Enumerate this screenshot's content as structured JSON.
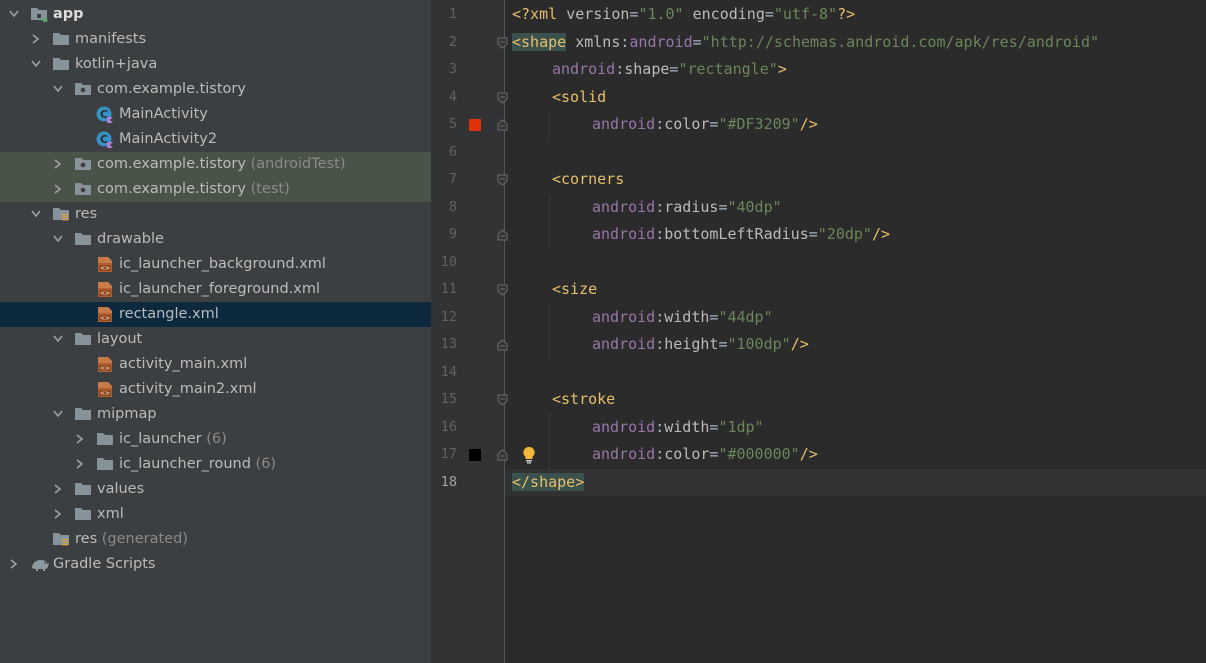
{
  "tree": [
    {
      "label": "app",
      "extra": "",
      "bold": true,
      "icon": "app-module-icon",
      "arrow": "expanded",
      "depth": 0,
      "bg": "none"
    },
    {
      "label": "manifests",
      "extra": "",
      "icon": "folder-icon",
      "arrow": "collapsed",
      "depth": 1,
      "bg": "none"
    },
    {
      "label": "kotlin+java",
      "extra": "",
      "icon": "folder-icon",
      "arrow": "expanded",
      "depth": 1,
      "bg": "none"
    },
    {
      "label": "com.example.tistory",
      "extra": "",
      "icon": "package-icon",
      "arrow": "expanded",
      "depth": 2,
      "bg": "none"
    },
    {
      "label": "MainActivity",
      "extra": "",
      "icon": "kotlin-class-icon",
      "arrow": "none",
      "depth": 3,
      "bg": "none"
    },
    {
      "label": "MainActivity2",
      "extra": "",
      "icon": "kotlin-class-icon",
      "arrow": "none",
      "depth": 3,
      "bg": "none"
    },
    {
      "label": "com.example.tistory",
      "extra": " (androidTest)",
      "icon": "package-icon",
      "arrow": "collapsed",
      "depth": 2,
      "bg": "test"
    },
    {
      "label": "com.example.tistory",
      "extra": " (test)",
      "icon": "package-icon",
      "arrow": "collapsed",
      "depth": 2,
      "bg": "test"
    },
    {
      "label": "res",
      "extra": "",
      "icon": "res-folder-icon",
      "arrow": "expanded",
      "depth": 1,
      "bg": "none"
    },
    {
      "label": "drawable",
      "extra": "",
      "icon": "folder-icon",
      "arrow": "expanded",
      "depth": 2,
      "bg": "none"
    },
    {
      "label": "ic_launcher_background.xml",
      "extra": "",
      "icon": "xml-file-icon",
      "arrow": "none",
      "depth": 3,
      "bg": "none"
    },
    {
      "label": "ic_launcher_foreground.xml",
      "extra": "",
      "icon": "xml-file-icon",
      "arrow": "none",
      "depth": 3,
      "bg": "none"
    },
    {
      "label": "rectangle.xml",
      "extra": "",
      "icon": "xml-file-icon",
      "arrow": "none",
      "depth": 3,
      "bg": "selected"
    },
    {
      "label": "layout",
      "extra": "",
      "icon": "folder-icon",
      "arrow": "expanded",
      "depth": 2,
      "bg": "none"
    },
    {
      "label": "activity_main.xml",
      "extra": "",
      "icon": "xml-file-icon",
      "arrow": "none",
      "depth": 3,
      "bg": "none"
    },
    {
      "label": "activity_main2.xml",
      "extra": "",
      "icon": "xml-file-icon",
      "arrow": "none",
      "depth": 3,
      "bg": "none"
    },
    {
      "label": "mipmap",
      "extra": "",
      "icon": "folder-icon",
      "arrow": "expanded",
      "depth": 2,
      "bg": "none"
    },
    {
      "label": "ic_launcher",
      "extra": " (6)",
      "icon": "folder-icon",
      "arrow": "collapsed",
      "depth": 3,
      "bg": "none"
    },
    {
      "label": "ic_launcher_round",
      "extra": " (6)",
      "icon": "folder-icon",
      "arrow": "collapsed",
      "depth": 3,
      "bg": "none"
    },
    {
      "label": "values",
      "extra": "",
      "icon": "folder-icon",
      "arrow": "collapsed",
      "depth": 2,
      "bg": "none"
    },
    {
      "label": "xml",
      "extra": "",
      "icon": "folder-icon",
      "arrow": "collapsed",
      "depth": 2,
      "bg": "none"
    },
    {
      "label": "res",
      "extra": " (generated)",
      "icon": "res-folder-icon",
      "arrow": "none",
      "depth": 1,
      "bg": "none"
    },
    {
      "label": "Gradle Scripts",
      "extra": "",
      "icon": "gradle-icon",
      "arrow": "collapsed",
      "depth": 0,
      "bg": "none"
    }
  ],
  "editor": {
    "current_line": 18,
    "lines": [
      {
        "n": "1",
        "indent": 0,
        "tokens": [
          [
            "dec",
            "<?xml "
          ],
          [
            "attr",
            "version"
          ],
          [
            "plain",
            "="
          ],
          [
            "val",
            "\"1.0\""
          ],
          [
            "plain",
            " "
          ],
          [
            "attr",
            "encoding"
          ],
          [
            "plain",
            "="
          ],
          [
            "val",
            "\"utf-8\""
          ],
          [
            "dec",
            "?>"
          ]
        ]
      },
      {
        "n": "2",
        "indent": 0,
        "tokens": [
          [
            "taghl",
            "<shape"
          ],
          [
            "plain",
            " "
          ],
          [
            "attr",
            "xmlns"
          ],
          [
            "plain",
            ":"
          ],
          [
            "ns",
            "android"
          ],
          [
            "plain",
            "="
          ],
          [
            "val",
            "\"http://schemas.android.com/apk/res/android\""
          ]
        ]
      },
      {
        "n": "3",
        "indent": 1,
        "tokens": [
          [
            "ns",
            "android"
          ],
          [
            "plain",
            ":"
          ],
          [
            "attr",
            "shape"
          ],
          [
            "plain",
            "="
          ],
          [
            "val",
            "\"rectangle\""
          ],
          [
            "tag",
            ">"
          ]
        ]
      },
      {
        "n": "4",
        "indent": 1,
        "tokens": [
          [
            "tag",
            "<solid"
          ]
        ]
      },
      {
        "n": "5",
        "indent": 2,
        "tokens": [
          [
            "ns",
            "android"
          ],
          [
            "plain",
            ":"
          ],
          [
            "attr",
            "color"
          ],
          [
            "plain",
            "="
          ],
          [
            "val",
            "\"#DF3209\""
          ],
          [
            "tag",
            "/>"
          ]
        ]
      },
      {
        "n": "6",
        "indent": 0,
        "tokens": []
      },
      {
        "n": "7",
        "indent": 1,
        "tokens": [
          [
            "tag",
            "<corners"
          ]
        ]
      },
      {
        "n": "8",
        "indent": 2,
        "tokens": [
          [
            "ns",
            "android"
          ],
          [
            "plain",
            ":"
          ],
          [
            "attr",
            "radius"
          ],
          [
            "plain",
            "="
          ],
          [
            "val",
            "\"40dp\""
          ]
        ]
      },
      {
        "n": "9",
        "indent": 2,
        "tokens": [
          [
            "ns",
            "android"
          ],
          [
            "plain",
            ":"
          ],
          [
            "attr",
            "bottomLeftRadius"
          ],
          [
            "plain",
            "="
          ],
          [
            "val",
            "\"20dp\""
          ],
          [
            "tag",
            "/>"
          ]
        ]
      },
      {
        "n": "10",
        "indent": 0,
        "tokens": []
      },
      {
        "n": "11",
        "indent": 1,
        "tokens": [
          [
            "tag",
            "<size"
          ]
        ]
      },
      {
        "n": "12",
        "indent": 2,
        "tokens": [
          [
            "ns",
            "android"
          ],
          [
            "plain",
            ":"
          ],
          [
            "attr",
            "width"
          ],
          [
            "plain",
            "="
          ],
          [
            "val",
            "\"44dp\""
          ]
        ]
      },
      {
        "n": "13",
        "indent": 2,
        "tokens": [
          [
            "ns",
            "android"
          ],
          [
            "plain",
            ":"
          ],
          [
            "attr",
            "height"
          ],
          [
            "plain",
            "="
          ],
          [
            "val",
            "\"100dp\""
          ],
          [
            "tag",
            "/>"
          ]
        ]
      },
      {
        "n": "14",
        "indent": 0,
        "tokens": []
      },
      {
        "n": "15",
        "indent": 1,
        "tokens": [
          [
            "tag",
            "<stroke"
          ]
        ]
      },
      {
        "n": "16",
        "indent": 2,
        "tokens": [
          [
            "ns",
            "android"
          ],
          [
            "plain",
            ":"
          ],
          [
            "attr",
            "width"
          ],
          [
            "plain",
            "="
          ],
          [
            "val",
            "\"1dp\""
          ]
        ]
      },
      {
        "n": "17",
        "indent": 2,
        "tokens": [
          [
            "ns",
            "android"
          ],
          [
            "plain",
            ":"
          ],
          [
            "attr",
            "color"
          ],
          [
            "plain",
            "="
          ],
          [
            "val",
            "\"#000000\""
          ],
          [
            "tag",
            "/>"
          ]
        ]
      },
      {
        "n": "18",
        "indent": 0,
        "tokens": [
          [
            "taghl",
            "</shape>"
          ]
        ]
      }
    ],
    "color_swatches": [
      {
        "line": 5,
        "color": "#DF3209"
      },
      {
        "line": 17,
        "color": "#000000"
      }
    ],
    "fold_markers": [
      {
        "line": 2,
        "kind": "open"
      },
      {
        "line": 4,
        "kind": "open"
      },
      {
        "line": 5,
        "kind": "close"
      },
      {
        "line": 7,
        "kind": "open"
      },
      {
        "line": 9,
        "kind": "close"
      },
      {
        "line": 11,
        "kind": "open"
      },
      {
        "line": 13,
        "kind": "close"
      },
      {
        "line": 15,
        "kind": "open"
      },
      {
        "line": 17,
        "kind": "close"
      }
    ],
    "intention_bulb_line": 17
  }
}
